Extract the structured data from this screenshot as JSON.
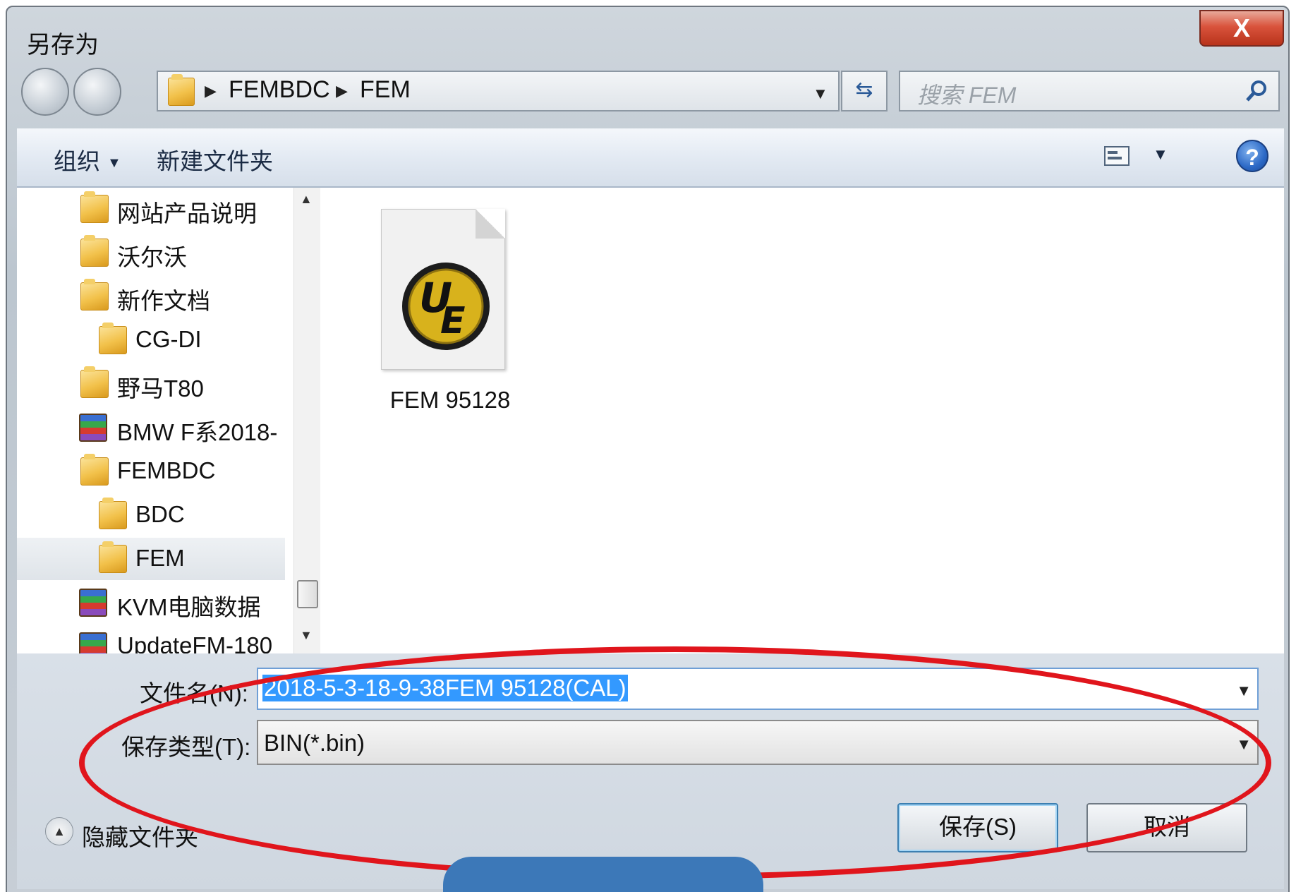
{
  "window": {
    "title": "另存为",
    "close_label": "X"
  },
  "address_bar": {
    "crumbs": [
      "FEMBDC",
      "FEM"
    ]
  },
  "search": {
    "placeholder": "搜索 FEM"
  },
  "toolbar": {
    "organize_label": "组织",
    "new_folder_label": "新建文件夹",
    "help_label": "?"
  },
  "nav_pane": {
    "items": [
      {
        "label": "网站产品说明",
        "icon": "folder-icon",
        "indent": 0
      },
      {
        "label": "沃尔沃",
        "icon": "folder-icon",
        "indent": 0
      },
      {
        "label": "新作文档",
        "icon": "folder-icon",
        "indent": 0
      },
      {
        "label": "CG-DI",
        "icon": "folder-icon",
        "indent": 1
      },
      {
        "label": "野马T80",
        "icon": "folder-icon",
        "indent": 0
      },
      {
        "label": "BMW F系2018-",
        "icon": "archive-icon",
        "indent": 0
      },
      {
        "label": "FEMBDC",
        "icon": "folder-icon",
        "indent": 0
      },
      {
        "label": "BDC",
        "icon": "folder-icon",
        "indent": 1
      },
      {
        "label": "FEM",
        "icon": "folder-icon",
        "indent": 1,
        "selected": true
      },
      {
        "label": "KVM电脑数据",
        "icon": "archive-icon",
        "indent": 0
      },
      {
        "label": "UpdateFM-180",
        "icon": "archive-icon",
        "indent": 0
      }
    ]
  },
  "files": [
    {
      "name": "FEM 95128",
      "icon": "ultraedit-file-icon"
    }
  ],
  "form": {
    "filename_label": "文件名(N):",
    "filename_value": "2018-5-3-18-9-38FEM 95128(CAL)",
    "filetype_label": "保存类型(T):",
    "filetype_value": "BIN(*.bin)"
  },
  "footer": {
    "hide_folders_label": "隐藏文件夹",
    "save_label": "保存(S)",
    "cancel_label": "取消"
  },
  "colors": {
    "annotation": "#e0151c",
    "selection": "#3399ff"
  }
}
